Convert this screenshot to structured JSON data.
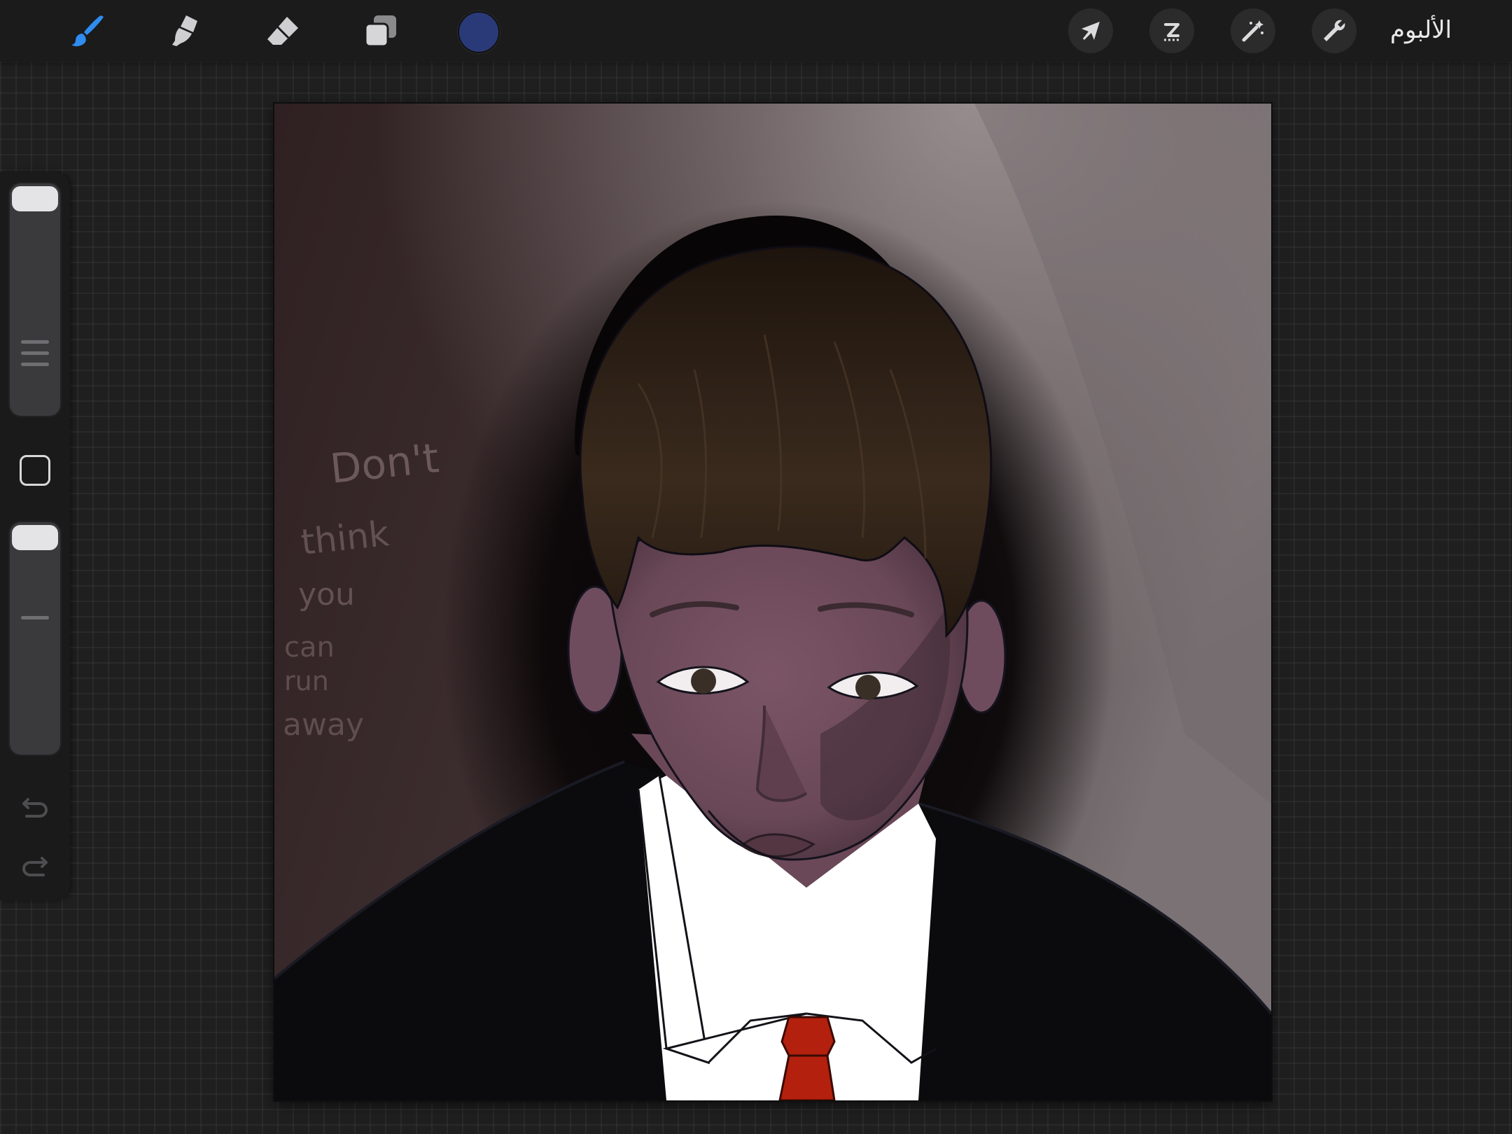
{
  "toolbar": {
    "tools": [
      {
        "name": "brush",
        "icon": "brush-icon",
        "active": true,
        "active_color": "#2f8cf0"
      },
      {
        "name": "smudge",
        "icon": "smudge-icon",
        "active": false
      },
      {
        "name": "eraser",
        "icon": "eraser-icon",
        "active": false
      },
      {
        "name": "layers",
        "icon": "layers-icon",
        "active": false
      }
    ],
    "current_color": "#2a3a78",
    "actions": [
      {
        "name": "transform",
        "icon": "arrow-cursor-icon"
      },
      {
        "name": "selection",
        "icon": "selection-s-icon"
      },
      {
        "name": "adjustments",
        "icon": "magic-wand-icon"
      },
      {
        "name": "actions",
        "icon": "wrench-icon"
      }
    ],
    "gallery_label": "الألبوم"
  },
  "sidebar": {
    "brush_size_slider": {
      "icon": "brush-size-slider",
      "level": 0.0
    },
    "modify_button": {
      "icon": "square-modify-icon"
    },
    "opacity_slider": {
      "icon": "opacity-slider",
      "level": 0.0
    },
    "undo": {
      "icon": "undo-icon"
    },
    "redo": {
      "icon": "redo-icon"
    }
  },
  "canvas": {
    "artwork": {
      "handwritten_words": [
        "Don't",
        "think",
        "you",
        "can",
        "run",
        "away"
      ],
      "palette": {
        "background": "#3b2c2d",
        "hair": "#2a1e14",
        "skin": "#6e4c5c",
        "suit": "#0b0b0d",
        "shirt": "#ffffff",
        "tie": "#b3200e"
      }
    }
  }
}
